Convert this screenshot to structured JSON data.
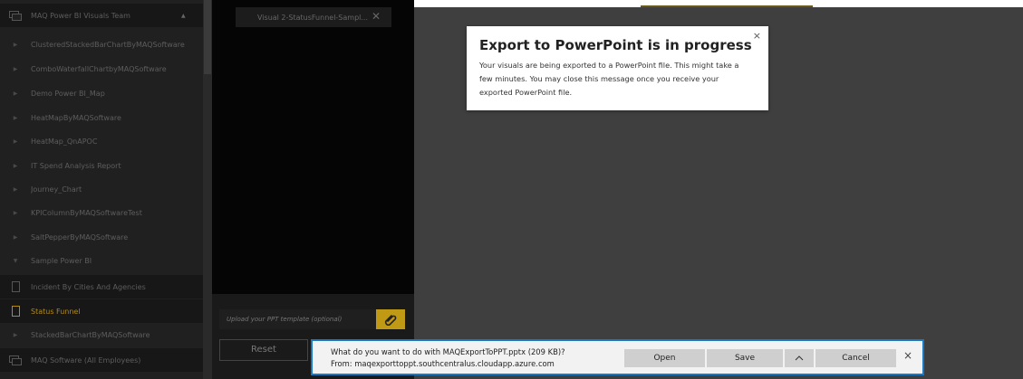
{
  "nav": {
    "workspace": "MAQ Power BI Visuals Team",
    "items": [
      "ClusteredStackedBarChartByMAQSoftware",
      "ComboWaterfallChartbyMAQSoftware",
      "Demo Power BI_Map",
      "HeatMapByMAQSoftware",
      "HeatMap_QnAPOC",
      "IT Spend Analysis Report",
      "Journey_Chart",
      "KPIColumnByMAQSoftwareTest",
      "SaltPepperByMAQSoftware"
    ],
    "expanded": "Sample Power BI",
    "pages": [
      "Incident By Cities And Agencies",
      "Status Funnel"
    ],
    "after": "StackedBarChartByMAQSoftware",
    "workspace2": "MAQ Software (All Employees)"
  },
  "panel": {
    "visual_tab": "Visual 2-StatusFunnel-Sampl...",
    "template_placeholder": "Upload your PPT template (optional)",
    "reset_label": "Reset"
  },
  "toast": {
    "title": "Export to PowerPoint is in progress",
    "body": "Your visuals are being exported to a PowerPoint file. This might take a few minutes. You may close this message once you receive your exported PowerPoint file.",
    "close": "×"
  },
  "download": {
    "question": "What do you want to do with MAQExportToPPT.pptx (209 KB)?",
    "source": "From: maqexporttoppt.southcentralus.cloudapp.azure.com",
    "open": "Open",
    "save": "Save",
    "more": "^",
    "cancel": "Cancel",
    "close": "×"
  },
  "colors": {
    "accent": "#c19a15",
    "active_text": "#b58a12",
    "canvas": "#3f3f3f",
    "download_border": "#1a78c2"
  }
}
